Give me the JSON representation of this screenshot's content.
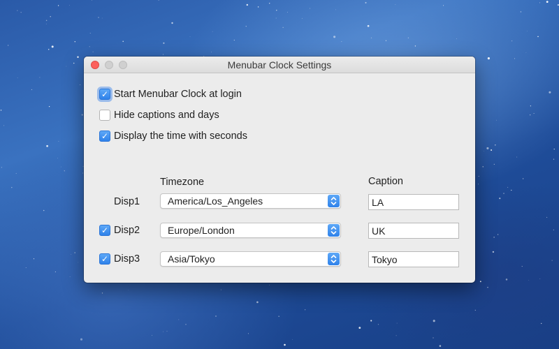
{
  "window": {
    "title": "Menubar Clock Settings"
  },
  "options": [
    {
      "label": "Start Menubar Clock at login",
      "checked": true
    },
    {
      "label": "Hide captions and days",
      "checked": false
    },
    {
      "label": "Display the time with seconds",
      "checked": true
    }
  ],
  "table": {
    "timezone_header": "Timezone",
    "caption_header": "Caption",
    "rows": [
      {
        "label": "Disp1",
        "has_checkbox": false,
        "enabled": true,
        "timezone": "America/Los_Angeles",
        "caption": "LA"
      },
      {
        "label": "Disp2",
        "has_checkbox": true,
        "enabled": true,
        "timezone": "Europe/London",
        "caption": "UK"
      },
      {
        "label": "Disp3",
        "has_checkbox": true,
        "enabled": true,
        "timezone": "Asia/Tokyo",
        "caption": "Tokyo"
      }
    ]
  },
  "icons": {
    "close": "close-icon",
    "minimize": "minimize-icon",
    "zoom": "zoom-icon",
    "checkmark": "checkmark-icon",
    "popup_arrows": "chevron-up-down-icon"
  },
  "colors": {
    "accent": "#3b8ef0",
    "close_button": "#fc605c",
    "window_bg": "#ececec"
  }
}
